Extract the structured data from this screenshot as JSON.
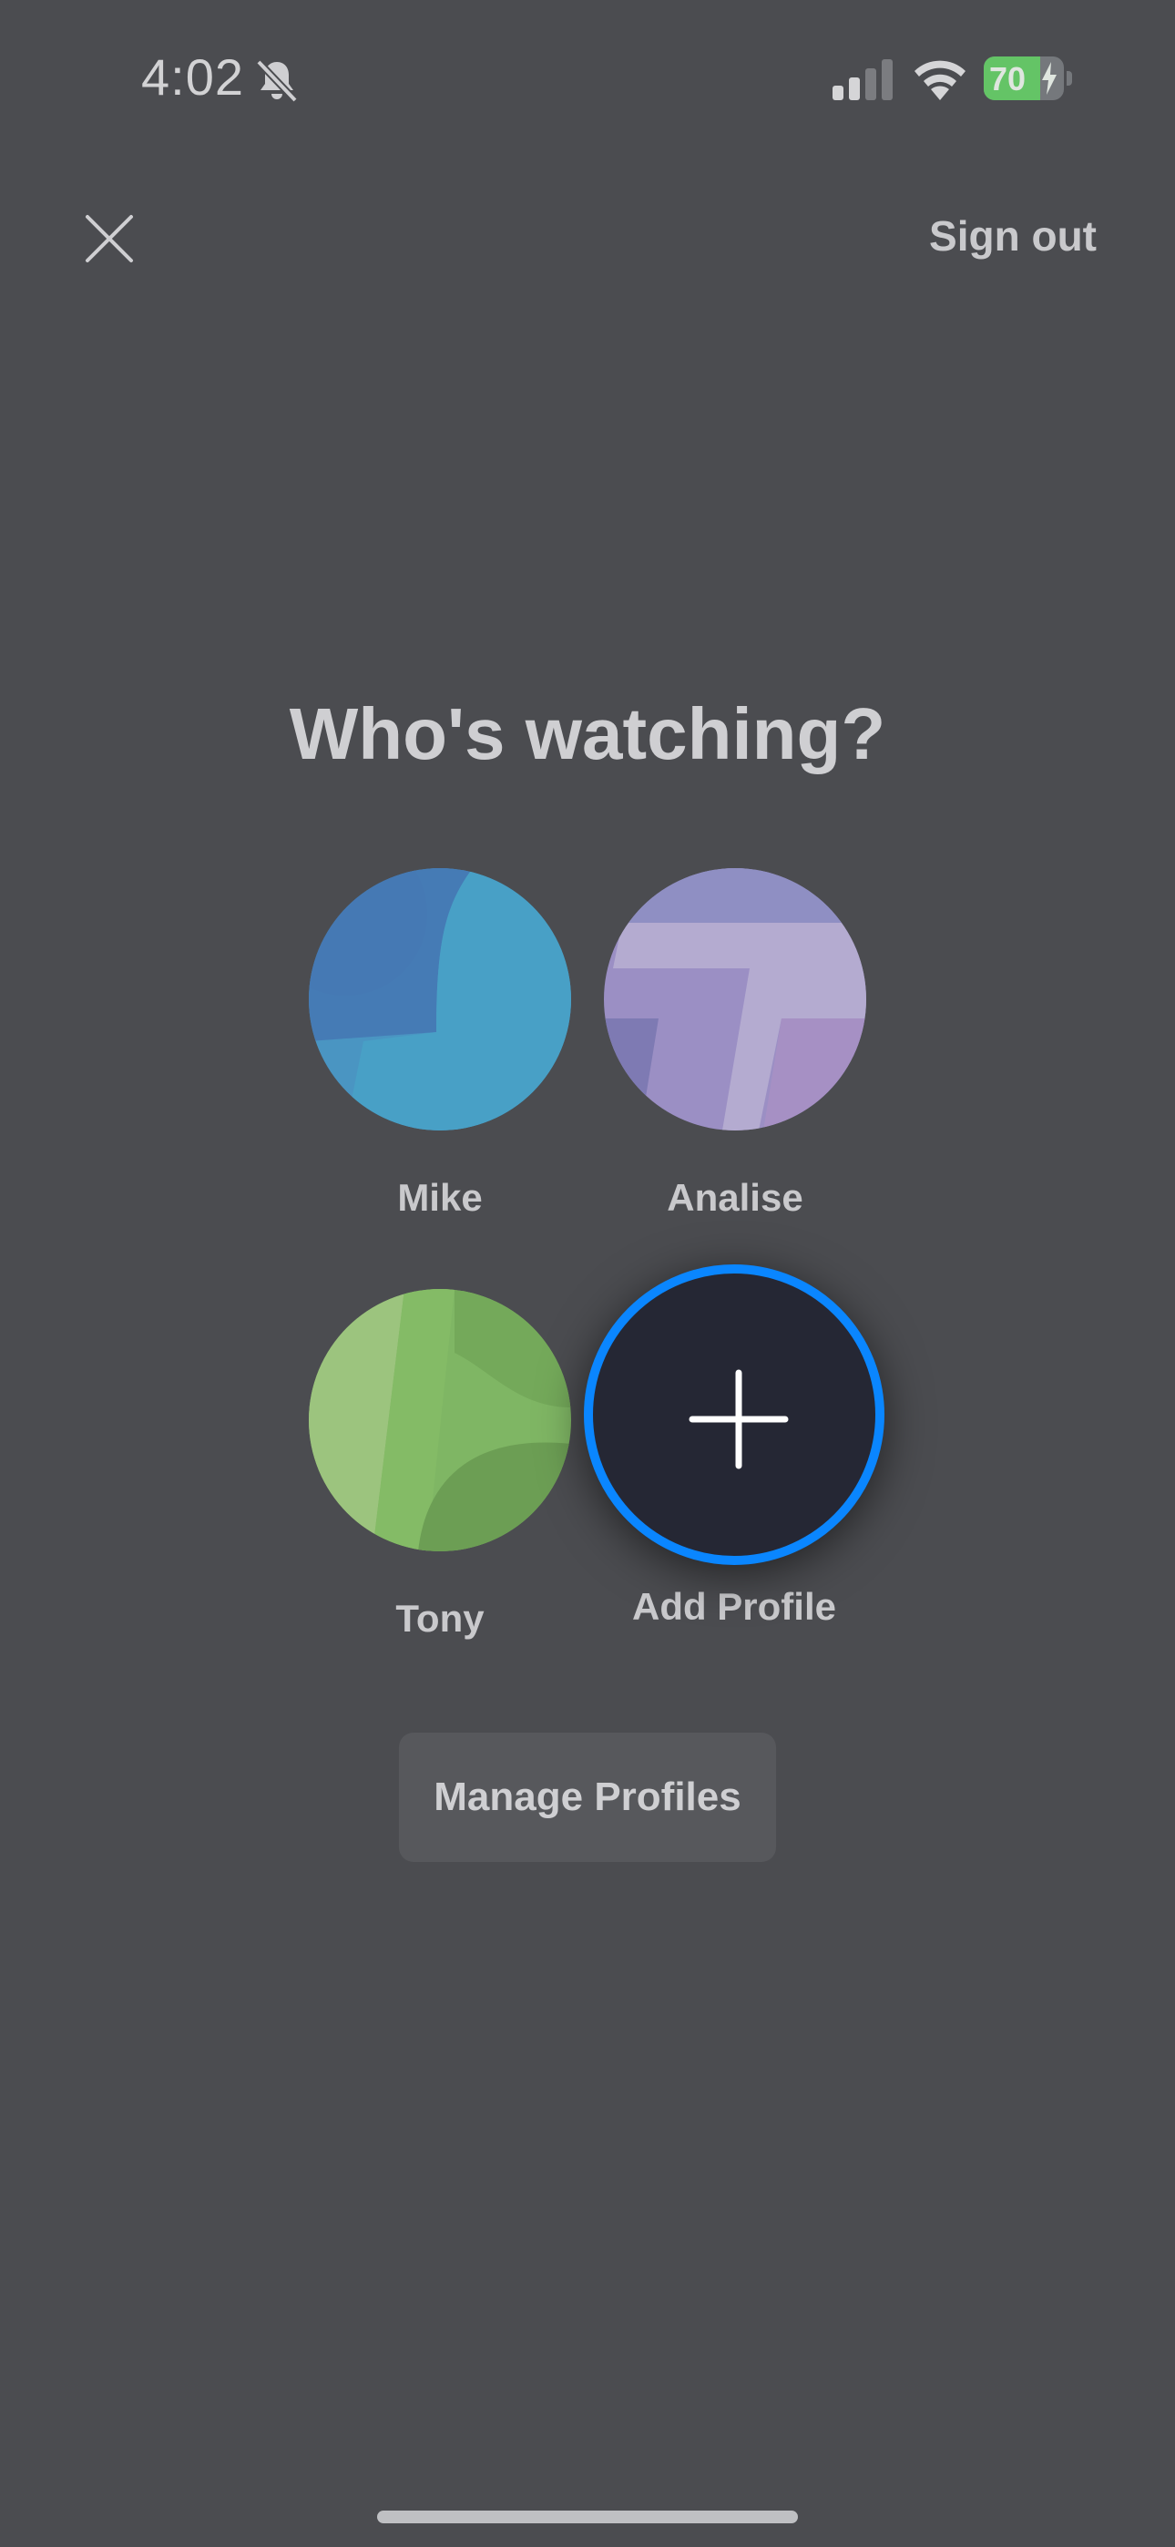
{
  "status_bar": {
    "time": "4:02",
    "battery_level": "70",
    "battery_fraction": 0.7,
    "icons": [
      "bell-slash-icon",
      "signal-icon",
      "wifi-icon",
      "battery-charging-icon"
    ]
  },
  "nav": {
    "close_icon": "close-icon",
    "sign_out_label": "Sign out"
  },
  "title": "Who's watching?",
  "profiles": [
    {
      "name": "Mike",
      "color": "#4a8fc0"
    },
    {
      "name": "Analise",
      "color": "#a59bcc"
    },
    {
      "name": "Tony",
      "color": "#7fb664"
    }
  ],
  "add_profile": {
    "label": "Add Profile",
    "icon": "plus-icon",
    "ring_color": "#0a86ff"
  },
  "manage_profiles_label": "Manage Profiles"
}
